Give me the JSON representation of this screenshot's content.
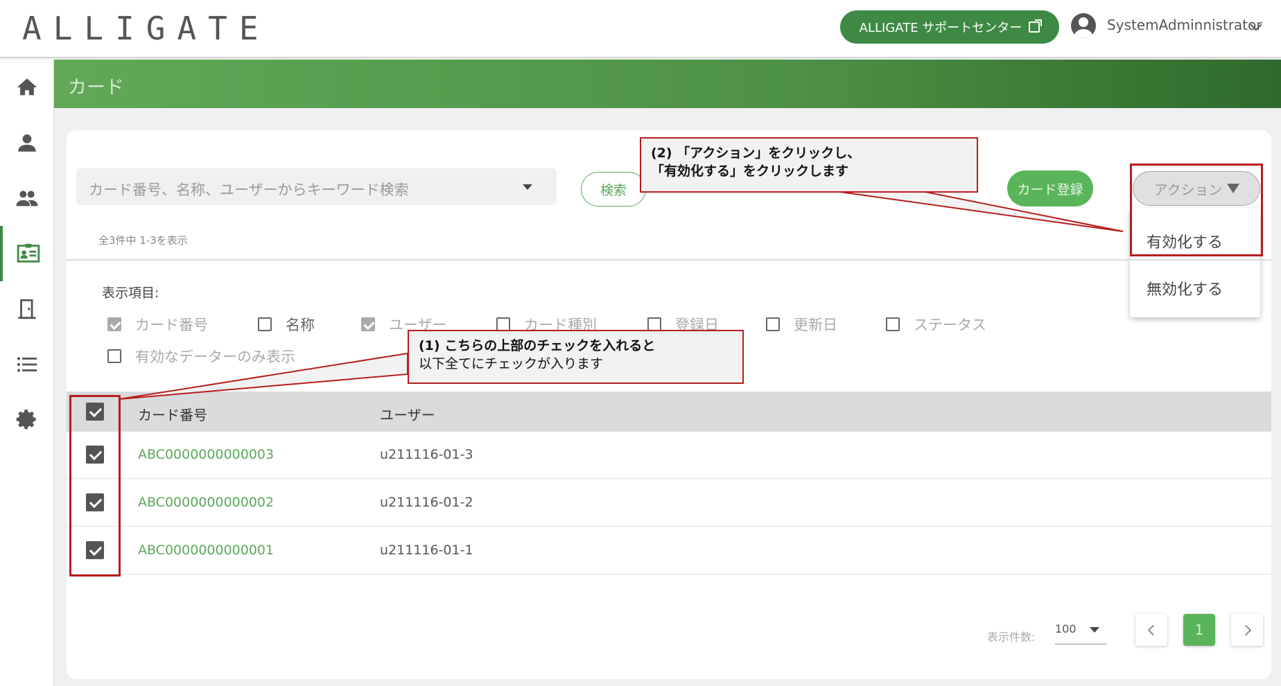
{
  "header": {
    "logo": "ALLIGATE",
    "support_label": "ALLIGATE サポートセンター",
    "username": "SystemAdminnistrator"
  },
  "sidebar": {
    "items": [
      {
        "name": "home",
        "icon": "home-icon"
      },
      {
        "name": "user",
        "icon": "user-icon"
      },
      {
        "name": "groups",
        "icon": "group-icon"
      },
      {
        "name": "cards",
        "icon": "id-card-icon",
        "active": true
      },
      {
        "name": "doors",
        "icon": "door-icon"
      },
      {
        "name": "list",
        "icon": "list-icon"
      },
      {
        "name": "settings",
        "icon": "gear-icon"
      }
    ]
  },
  "page": {
    "title": "カード"
  },
  "search": {
    "placeholder": "カード番号、名称、ユーザーからキーワード検索",
    "button_label": "検索"
  },
  "toolbar": {
    "register_label": "カード登録",
    "action_label": "アクション",
    "action_menu": [
      "有効化する",
      "無効化する"
    ]
  },
  "result_count": "全3件中 1-3を表示",
  "display_items": {
    "label": "表示項目:",
    "options": [
      {
        "label": "カード番号",
        "checked": true,
        "disabled": true
      },
      {
        "label": "名称",
        "checked": false
      },
      {
        "label": "ユーザー",
        "checked": true,
        "disabled": true
      },
      {
        "label": "カード種別",
        "checked": false
      },
      {
        "label": "登録日",
        "checked": false
      },
      {
        "label": "更新日",
        "checked": false
      },
      {
        "label": "ステータス",
        "checked": false
      },
      {
        "label": "有効なデーターのみ表示",
        "checked": false
      }
    ]
  },
  "table": {
    "headers": [
      "カード番号",
      "ユーザー"
    ],
    "rows": [
      {
        "card": "ABC0000000000003",
        "user": "u211116-01-3",
        "checked": true
      },
      {
        "card": "ABC0000000000002",
        "user": "u211116-01-2",
        "checked": true
      },
      {
        "card": "ABC0000000000001",
        "user": "u211116-01-1",
        "checked": true
      }
    ]
  },
  "pagination": {
    "per_page_label": "表示件数:",
    "per_page_value": "100",
    "current_page": "1"
  },
  "annotations": {
    "step2_line1": "(2) 「アクション」をクリックし、",
    "step2_line2": "「有効化する」をクリックします",
    "step1_line1": "(1) こちらの上部のチェックを入れると",
    "step1_line2": "以下全てにチェックが入ります"
  },
  "colors": {
    "accent": "#3e8a45",
    "link": "#5aa85a",
    "annotation": "#b71c1c"
  }
}
